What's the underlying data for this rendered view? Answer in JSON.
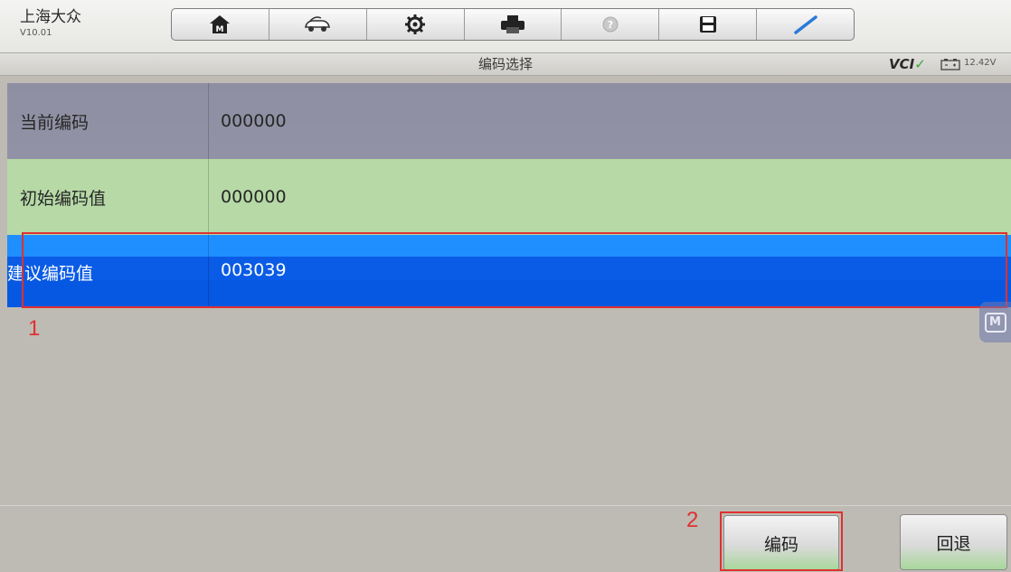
{
  "app": {
    "brand": "上海大众",
    "version": "V10.01"
  },
  "toolbar": {
    "buttons": [
      {
        "icon": "home-icon"
      },
      {
        "icon": "vehicle-icon"
      },
      {
        "icon": "settings-gear-icon"
      },
      {
        "icon": "printer-icon"
      },
      {
        "icon": "help-icon"
      },
      {
        "icon": "save-icon"
      },
      {
        "icon": "pen-icon"
      }
    ]
  },
  "header": {
    "title": "编码选择",
    "vci_label": "VCI",
    "vci_status": "connected",
    "voltage": "12.42V"
  },
  "rows": [
    {
      "label": "当前编码",
      "value": "000000"
    },
    {
      "label": "初始编码值",
      "value": "000000"
    },
    {
      "label": "建议编码值",
      "value": "003039",
      "selected": true
    }
  ],
  "annotations": {
    "step1": "1",
    "step2": "2"
  },
  "floating": {
    "label": "M"
  },
  "footer": {
    "code_button": "编码",
    "back_button": "回退"
  },
  "colors": {
    "selected_row": "#0a5ce6",
    "current_row": "#9292a6",
    "initial_row": "#b6d9a6",
    "annotation": "#e03030"
  }
}
